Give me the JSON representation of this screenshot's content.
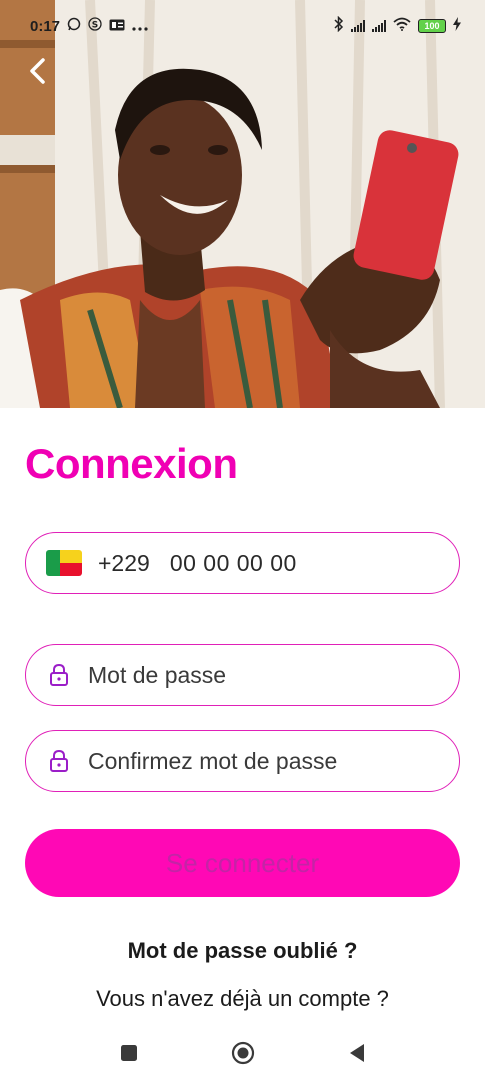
{
  "status_bar": {
    "time": "0:17",
    "battery": "100"
  },
  "login": {
    "title": "Connexion",
    "phone_code": "+229",
    "phone_placeholder": "00 00 00 00",
    "password_placeholder": "Mot de passe",
    "confirm_password_placeholder": "Confirmez mot de passe",
    "submit_label": "Se connecter",
    "forgot_password": "Mot de passe oublié ?",
    "signup_prompt": "Vous n'avez déjà un compte ?"
  },
  "colors": {
    "accent": "#f000b4",
    "button": "#ff08b5",
    "field_border": "#e020b8",
    "lock_icon": "#9b1ec8"
  },
  "icons": {
    "back": "chevron-left-icon",
    "lock": "lock-icon",
    "flag": "benin-flag-icon",
    "nav_recents": "square-icon",
    "nav_home": "circle-icon",
    "nav_back": "triangle-back-icon"
  }
}
